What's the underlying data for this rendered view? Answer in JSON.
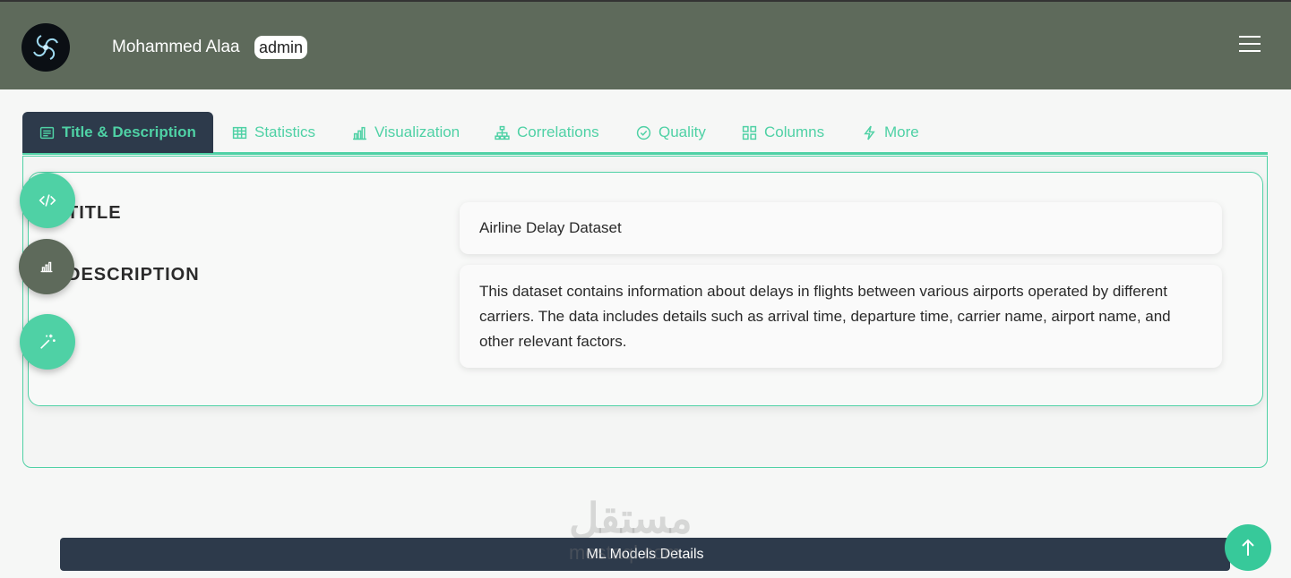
{
  "header": {
    "user_name": "Mohammed Alaa",
    "role": "admin",
    "logo_icon": "swirl-logo",
    "menu_icon": "hamburger-icon"
  },
  "tabs": [
    {
      "label": "Title & Description",
      "icon": "document-icon",
      "active": true
    },
    {
      "label": "Statistics",
      "icon": "table-icon"
    },
    {
      "label": "Visualization",
      "icon": "bar-chart-icon"
    },
    {
      "label": "Correlations",
      "icon": "hierarchy-icon"
    },
    {
      "label": "Quality",
      "icon": "check-circle-icon"
    },
    {
      "label": "Columns",
      "icon": "grid-icon"
    },
    {
      "label": "More",
      "icon": "lightning-icon"
    }
  ],
  "content": {
    "title_label": "TITLE",
    "description_label": "DESCRIPTION",
    "title_value": "Airline Delay Dataset",
    "description_value": "This dataset contains information about delays in flights between various airports operated by different carriers. The data includes details such as arrival time, departure time, carrier name, airport name, and other relevant factors."
  },
  "floating_buttons": [
    {
      "icon": "code-icon",
      "color": "#4fd1a5"
    },
    {
      "icon": "bar-chart-icon",
      "color": "#5e6a5b"
    },
    {
      "icon": "magic-wand-icon",
      "color": "#4fd1a5"
    }
  ],
  "bottom_bar": {
    "label": "ML Models Details"
  },
  "watermark": {
    "text": "مستقل",
    "url": "mostaql.com"
  },
  "colors": {
    "accent": "#4fd1a5",
    "header_bg": "#5e6a5b",
    "dark": "#2d3a4b"
  }
}
